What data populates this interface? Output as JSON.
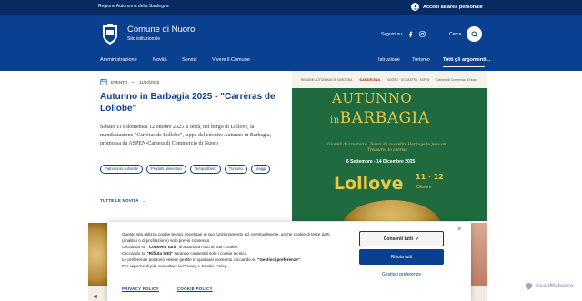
{
  "topbar": {
    "region": "Regione Autonoma della Sardegna",
    "login": "Accedi all'area personale"
  },
  "header": {
    "title": "Comune di Nuoro",
    "subtitle": "Sito istituzionale",
    "follow": "Seguici su",
    "search": "Cerca"
  },
  "nav": {
    "left": [
      "Amministrazione",
      "Novità",
      "Servizi",
      "Vivere il Comune"
    ],
    "right": [
      "Istruzione",
      "Turismo",
      "Tutti gli argomenti..."
    ]
  },
  "article": {
    "category": "EVENTO",
    "date": "11/10/2025",
    "title": "Autunno in Barbagia 2025 - \"Carrèras de Lollobe\"",
    "lead": "Sabato 11 e domenica 12 ottobre 2025 si terrà, nel borgo di Lollove, la manifestazione \"Carrèras de Lollobe\", tappa del circuito Autunno in Barbagia, promossa da ASPEN-Camera di Commercio di Nuoro",
    "tags": [
      "Patrimonio culturale",
      "Prodotti alimentari",
      "Tempo libero",
      "Turismo",
      "Viaggi"
    ],
    "all_news": "TUTTE LE NOVITÀ"
  },
  "poster": {
    "logos": [
      "REGIONE AUTÒNOMA DE SARDIGNA",
      "SARDEGNA",
      "NUORO · OGLIASTRA · ASPEN",
      "Camera di Commercio di Nuoro"
    ],
    "title_line1": "AUTUNNO",
    "title_in": "in",
    "title_line2": "BARBAGIA",
    "subtitle": "Giorolli de tzuatorus. Tesori da custodire Heritage to pass on. Treasures to cherish",
    "dates": "6 Settembre - 14 Dicembre 2025",
    "place": "Lollove",
    "days": "11 · 12",
    "month": "Ottobre"
  },
  "cookie": {
    "p1": "Questo sito utilizza cookie tecnici necessari al suo funzionamento ed, eventualmente, anche cookie di terze parti (analitici o di profilazione) solo previo consenso.",
    "p2a": "Cliccando su ",
    "p2b": "\"Consenti tutti\"",
    "p2c": " si autorizza l'uso di tutti i cookie.",
    "p3a": "Cliccando su ",
    "p3b": "\"Rifiuta tutti\"",
    "p3c": " saranno consentiti solo i cookie tecnici.",
    "p4a": "Le preferenze possono essere gestite in qualsiasi momento cliccando su ",
    "p4b": "\"Gestisci preferenze\"",
    "p4c": ".",
    "p5": "Per saperne di più, consultare la Privacy e Cookie Policy.",
    "accept": "Consenti tutti",
    "reject": "Rifiuta tutti",
    "prefs": "Gestisci preferenze",
    "privacy": "PRIVACY POLICY",
    "cookie_policy": "COOKIE POLICY",
    "close": "×"
  },
  "watermark": "ScanMalware",
  "colors": {
    "primary": "#0b3f8f",
    "topbar": "#062b63",
    "poster_green": "#1f6a3f",
    "poster_gold": "#e7c84a"
  },
  "icons": [
    "user-icon",
    "crest-icon",
    "facebook-icon",
    "instagram-icon",
    "search-icon",
    "calendar-icon",
    "arrow-right-icon",
    "speaker-icon",
    "close-icon"
  ]
}
